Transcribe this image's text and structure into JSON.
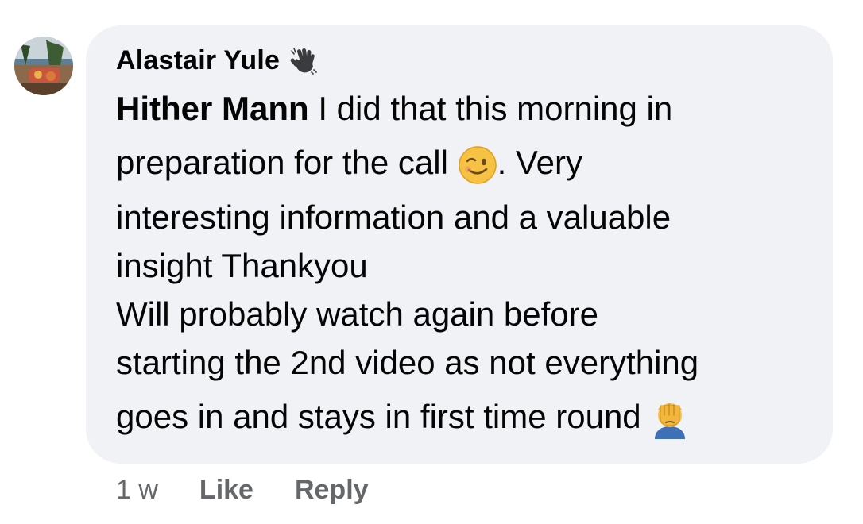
{
  "comment": {
    "author": "Alastair Yule",
    "badge_icon": "waving-hand-icon",
    "mention": "Hither Mann",
    "lines": [
      " I did that this morning in",
      "preparation for the call ",
      ". Very",
      "interesting information and a valuable",
      "insight Thankyou",
      "Will probably watch again before",
      "starting the 2nd video as not everything",
      "goes in and stays in first time round "
    ],
    "emojis": [
      "winking-face-icon",
      "face-palm-icon"
    ]
  },
  "footer": {
    "timestamp": "1 w",
    "like_label": "Like",
    "reply_label": "Reply"
  },
  "colors": {
    "bubble": "#f0f2f5",
    "text": "#050505",
    "meta": "#65676b"
  }
}
